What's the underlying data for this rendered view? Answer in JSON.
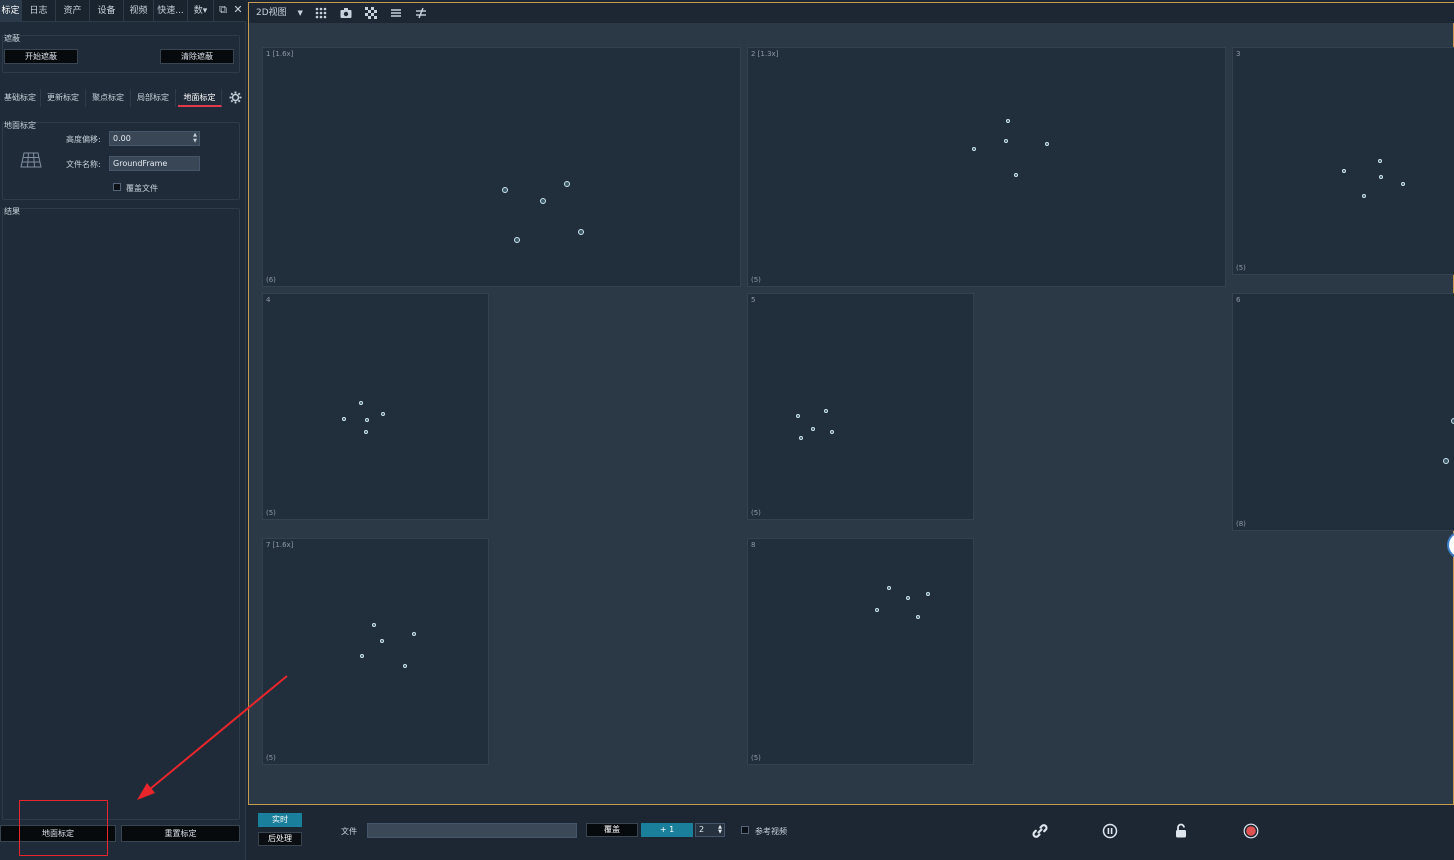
{
  "left_panel": {
    "tabs": [
      {
        "label": "标定",
        "active": true
      },
      {
        "label": "日志"
      },
      {
        "label": "资产"
      },
      {
        "label": "设备"
      },
      {
        "label": "视频"
      },
      {
        "label": "快速..."
      },
      {
        "label": "数▾"
      }
    ],
    "mask_group": {
      "title": "遮蔽",
      "start_button": "开始遮蔽",
      "clear_button": "清除遮蔽"
    },
    "sub_tabs": [
      {
        "label": "基础标定"
      },
      {
        "label": "更新标定"
      },
      {
        "label": "聚点标定"
      },
      {
        "label": "局部标定"
      },
      {
        "label": "地面标定",
        "active": true
      }
    ],
    "ground_group": {
      "title": "地面标定",
      "height_offset_label": "高度偏移:",
      "height_offset_value": "0.00",
      "file_name_label": "文件名称:",
      "file_name_value": "GroundFrame",
      "overwrite_label": "覆盖文件",
      "icon": "ground-grid-icon"
    },
    "result_title": "结果",
    "ground_calibrate_button": "地面标定",
    "reset_calibrate_button": "重置标定"
  },
  "toolbar": {
    "view_mode": "2D视图"
  },
  "views": [
    {
      "label": "1 [1.6x]",
      "count": "(6)"
    },
    {
      "label": "2 [1.3x]",
      "count": "(5)"
    },
    {
      "label": "3",
      "count": "(5)"
    },
    {
      "label": "4",
      "count": "(5)"
    },
    {
      "label": "5",
      "count": "(5)"
    },
    {
      "label": "6",
      "count": "(8)"
    },
    {
      "label": "7 [1.6x]",
      "count": "(5)"
    },
    {
      "label": "8",
      "count": "(5)"
    }
  ],
  "bottom": {
    "realtime_button": "实时",
    "postprocess_button": "后处理",
    "file_label": "文件",
    "file_value": "",
    "overlay_button": "覆盖",
    "step_button": "+ 1",
    "step_value": "2",
    "reference_video_label": "参考视频"
  },
  "colors": {
    "accent": "#1a7f9a",
    "active_tab_underline": "#e2384b",
    "main_border": "#c79a52",
    "record": "#e05252",
    "annotation": "#e8262b"
  }
}
